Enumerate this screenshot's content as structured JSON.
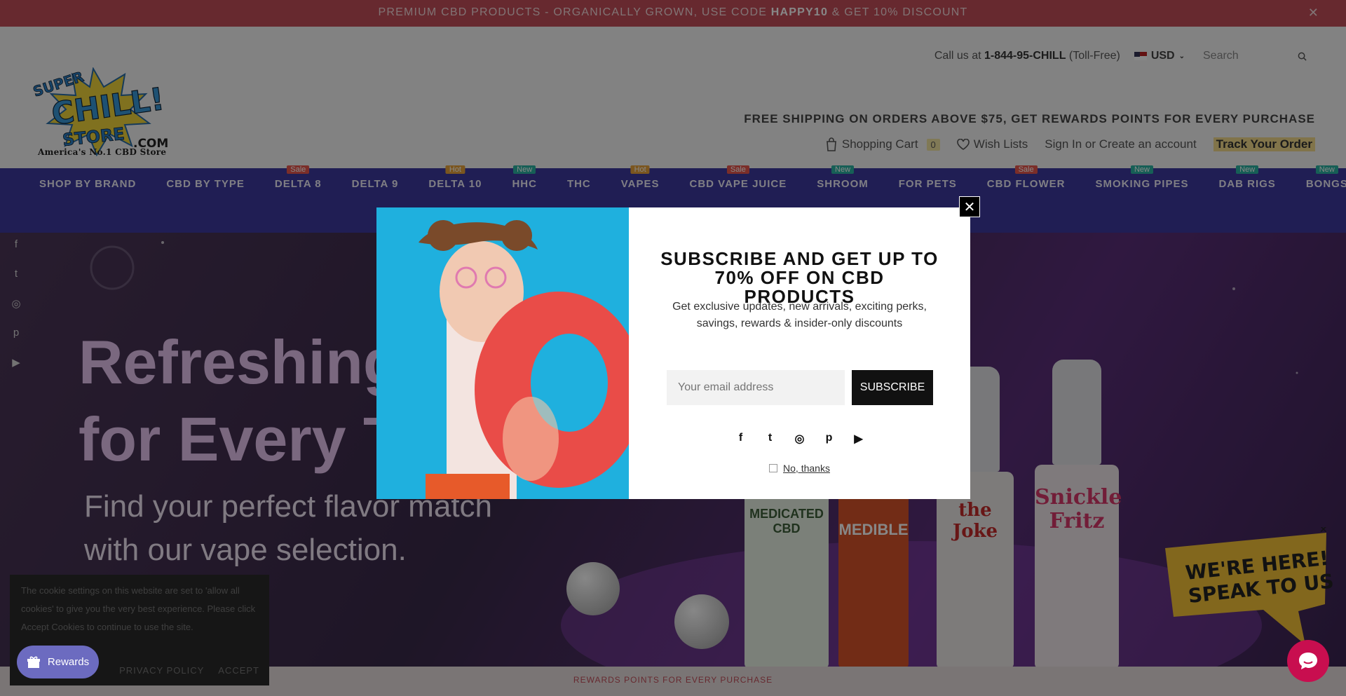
{
  "announcement": {
    "text_before": "PREMIUM CBD PRODUCTS - ORGANICALLY GROWN, USE CODE ",
    "code": "HAPPY10",
    "text_after": " & GET 10% DISCOUNT",
    "close": "✕"
  },
  "header": {
    "logo_tagline": "America's No.1 CBD Store",
    "logo_main": "SUPER CHILL! STORE",
    "logo_com": ".COM",
    "call_prefix": "Call us at ",
    "phone": "1-844-95-CHILL",
    "toll_free": " (Toll-Free)",
    "currency": "USD",
    "search_placeholder": "Search",
    "free_shipping": "FREE SHIPPING ON ORDERS ABOVE $75, GET REWARDS POINTS FOR EVERY PURCHASE",
    "shopping_cart": "Shopping Cart",
    "cart_count": "0",
    "wish_lists": "Wish Lists",
    "sign_in": "Sign In",
    "or": " or ",
    "create_account": "Create an account",
    "track_order": "Track Your Order"
  },
  "nav": {
    "items": [
      {
        "label": "SHOP BY BRAND",
        "tag": ""
      },
      {
        "label": "CBD BY TYPE",
        "tag": ""
      },
      {
        "label": "DELTA 8",
        "tag": "Sale"
      },
      {
        "label": "DELTA 9",
        "tag": ""
      },
      {
        "label": "DELTA 10",
        "tag": "Hot"
      },
      {
        "label": "HHC",
        "tag": "New"
      },
      {
        "label": "THC",
        "tag": ""
      },
      {
        "label": "VAPES",
        "tag": "Hot"
      },
      {
        "label": "CBD VAPE JUICE",
        "tag": "Sale"
      },
      {
        "label": "SHROOM",
        "tag": "New"
      },
      {
        "label": "FOR PETS",
        "tag": ""
      },
      {
        "label": "CBD FLOWER",
        "tag": "Sale"
      },
      {
        "label": "SMOKING PIPES",
        "tag": "New"
      },
      {
        "label": "DAB RIGS",
        "tag": "New"
      },
      {
        "label": "BONGS",
        "tag": "New"
      }
    ],
    "tag_colors": {
      "Sale": "#e8584f",
      "Hot": "#e8a33c",
      "New": "#2bb3a3"
    }
  },
  "hero": {
    "headline_line1": "Refreshing V",
    "headline_line2": "for Every Ta",
    "sub_line1": "Find your perfect flavor match",
    "sub_line2": "with our vape selection.",
    "bottles": [
      "MEDICATED CBD",
      "MEDIBLE",
      "the Joke",
      "Snickle Fritz"
    ]
  },
  "modal": {
    "close": "✕",
    "title": "SUBSCRIBE AND GET UP TO 70% OFF ON CBD PRODUCTS",
    "description": "Get exclusive updates, new arrivals, exciting perks, savings, rewards & insider-only discounts",
    "email_placeholder": "Your email address",
    "subscribe_label": "SUBSCRIBE",
    "no_thanks": "No, thanks"
  },
  "social_icons": [
    "facebook",
    "twitter",
    "instagram",
    "pinterest",
    "youtube"
  ],
  "cookie": {
    "text": "The cookie settings on this website are set to 'allow all cookies' to give you the very best experience. Please click Accept Cookies to continue to use the site.",
    "privacy": "PRIVACY POLICY",
    "accept": "ACCEPT"
  },
  "rewards_label": "Rewards",
  "bottom_strip": "REWARDS POINTS FOR EVERY PURCHASE",
  "chat_badge": {
    "line1": "WE'RE HERE!",
    "line2": "SPEAK TO US"
  }
}
